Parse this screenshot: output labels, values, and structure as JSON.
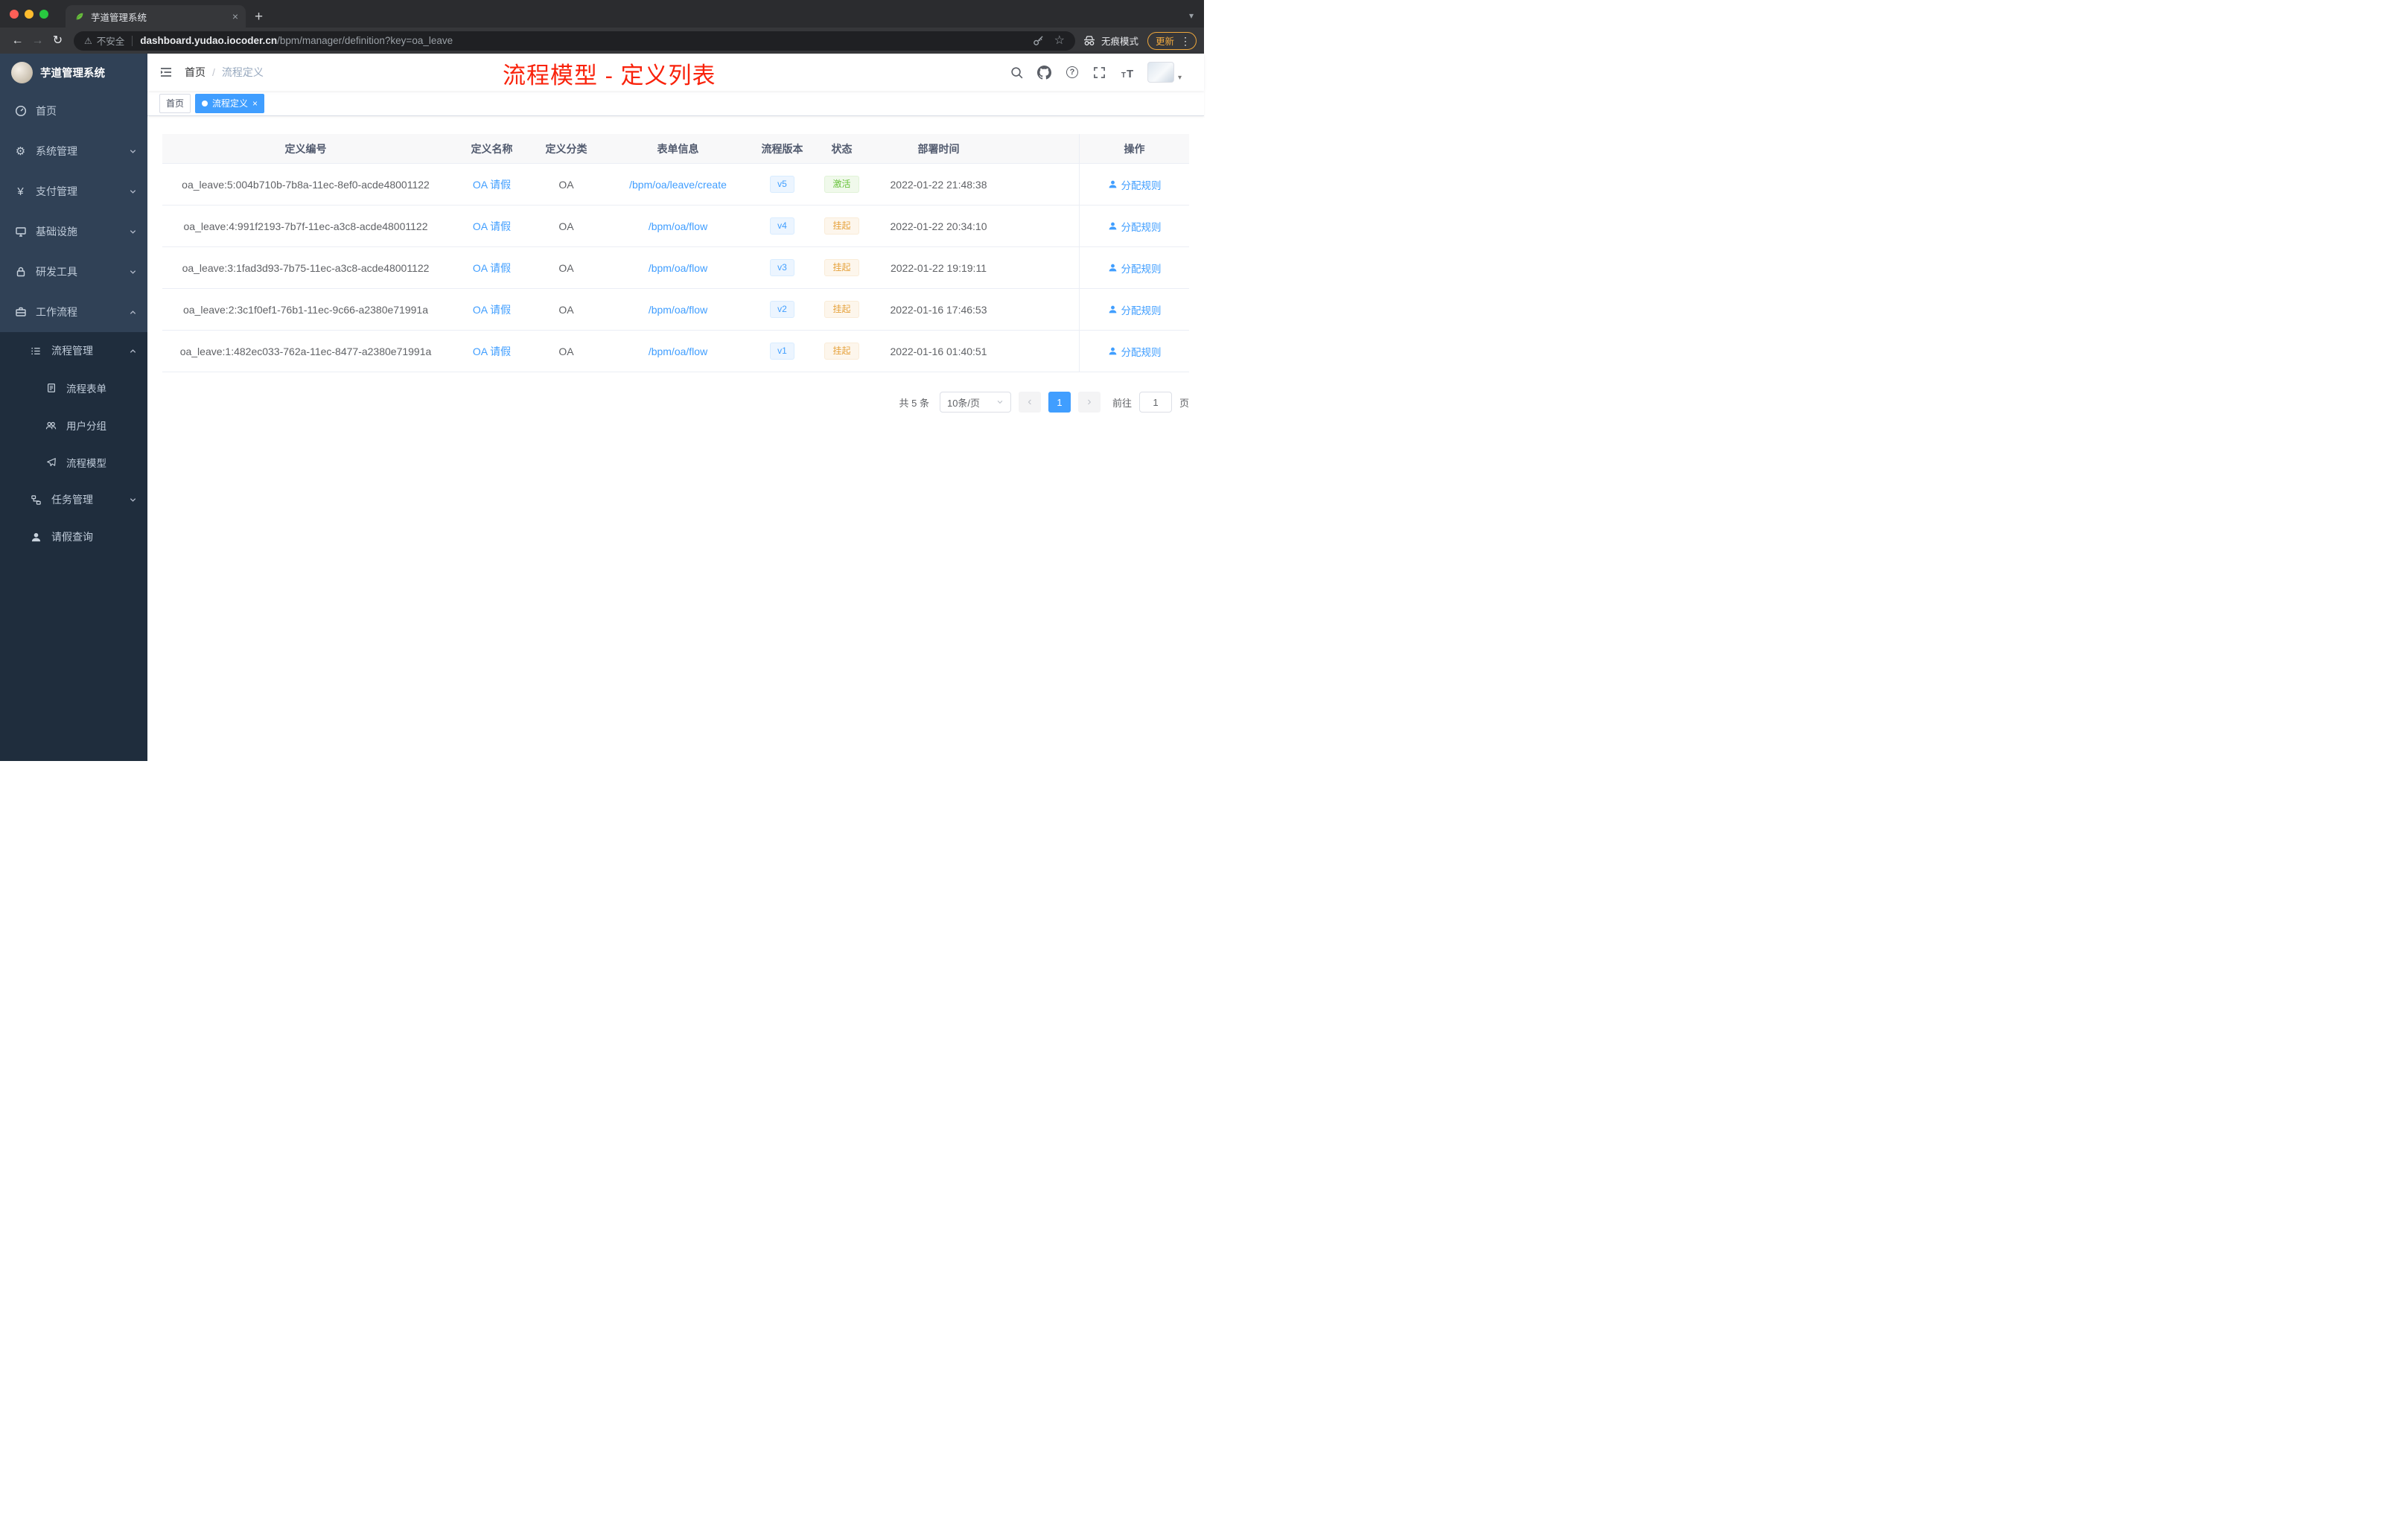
{
  "browser": {
    "tab_title": "芋道管理系统",
    "security_label": "不安全",
    "url_host": "dashboard.yudao.iocoder.cn",
    "url_path": "/bpm/manager/definition?key=oa_leave",
    "incognito_label": "无痕模式",
    "update_label": "更新"
  },
  "icons": {
    "back": "←",
    "forward": "→",
    "reload": "↻",
    "warning": "⚠",
    "star": "☆",
    "kebab": "⋮",
    "close": "×",
    "plus": "+",
    "caret_down": "▾",
    "gear": "⚙",
    "yen": "¥",
    "question": "?",
    "font_t": "T",
    "chevron_left": "‹",
    "chevron_right": "›"
  },
  "sidebar": {
    "logo_title": "芋道管理系统",
    "menu": [
      "首页",
      "系统管理",
      "支付管理",
      "基础设施",
      "研发工具",
      "工作流程"
    ],
    "submenu": {
      "process": "流程管理",
      "process_children": [
        "流程表单",
        "用户分组",
        "流程模型"
      ],
      "task": "任务管理",
      "leave": "请假查询"
    }
  },
  "header": {
    "breadcrumb_home": "首页",
    "breadcrumb_sep": "/",
    "breadcrumb_current": "流程定义",
    "annotation": "流程模型 - 定义列表"
  },
  "tags": [
    {
      "label": "首页",
      "active": false
    },
    {
      "label": "流程定义",
      "active": true
    }
  ],
  "table": {
    "columns": [
      "定义编号",
      "定义名称",
      "定义分类",
      "表单信息",
      "流程版本",
      "状态",
      "部署时间",
      "操作"
    ],
    "rows": [
      {
        "id": "oa_leave:5:004b710b-7b8a-11ec-8ef0-acde48001122",
        "name": "OA 请假",
        "category": "OA",
        "form": "/bpm/oa/leave/create",
        "version": "v5",
        "status": "激活",
        "status_type": "success",
        "time": "2022-01-22 21:48:38",
        "action": "分配规则"
      },
      {
        "id": "oa_leave:4:991f2193-7b7f-11ec-a3c8-acde48001122",
        "name": "OA 请假",
        "category": "OA",
        "form": "/bpm/oa/flow",
        "version": "v4",
        "status": "挂起",
        "status_type": "warning",
        "time": "2022-01-22 20:34:10",
        "action": "分配规则"
      },
      {
        "id": "oa_leave:3:1fad3d93-7b75-11ec-a3c8-acde48001122",
        "name": "OA 请假",
        "category": "OA",
        "form": "/bpm/oa/flow",
        "version": "v3",
        "status": "挂起",
        "status_type": "warning",
        "time": "2022-01-22 19:19:11",
        "action": "分配规则"
      },
      {
        "id": "oa_leave:2:3c1f0ef1-76b1-11ec-9c66-a2380e71991a",
        "name": "OA 请假",
        "category": "OA",
        "form": "/bpm/oa/flow",
        "version": "v2",
        "status": "挂起",
        "status_type": "warning",
        "time": "2022-01-16 17:46:53",
        "action": "分配规则"
      },
      {
        "id": "oa_leave:1:482ec033-762a-11ec-8477-a2380e71991a",
        "name": "OA 请假",
        "category": "OA",
        "form": "/bpm/oa/flow",
        "version": "v1",
        "status": "挂起",
        "status_type": "warning",
        "time": "2022-01-16 01:40:51",
        "action": "分配规则"
      }
    ]
  },
  "pagination": {
    "total": "共 5 条",
    "page_size": "10条/页",
    "current_page": "1",
    "goto_label": "前往",
    "goto_value": "1",
    "page_unit": "页"
  },
  "colors": {
    "accent": "#409eff",
    "success": "#67c23a",
    "warning": "#e6a23c",
    "annotation_red": "#f9220b",
    "sidebar_bg": "#304156",
    "submenu_bg": "#1f2d3d"
  }
}
